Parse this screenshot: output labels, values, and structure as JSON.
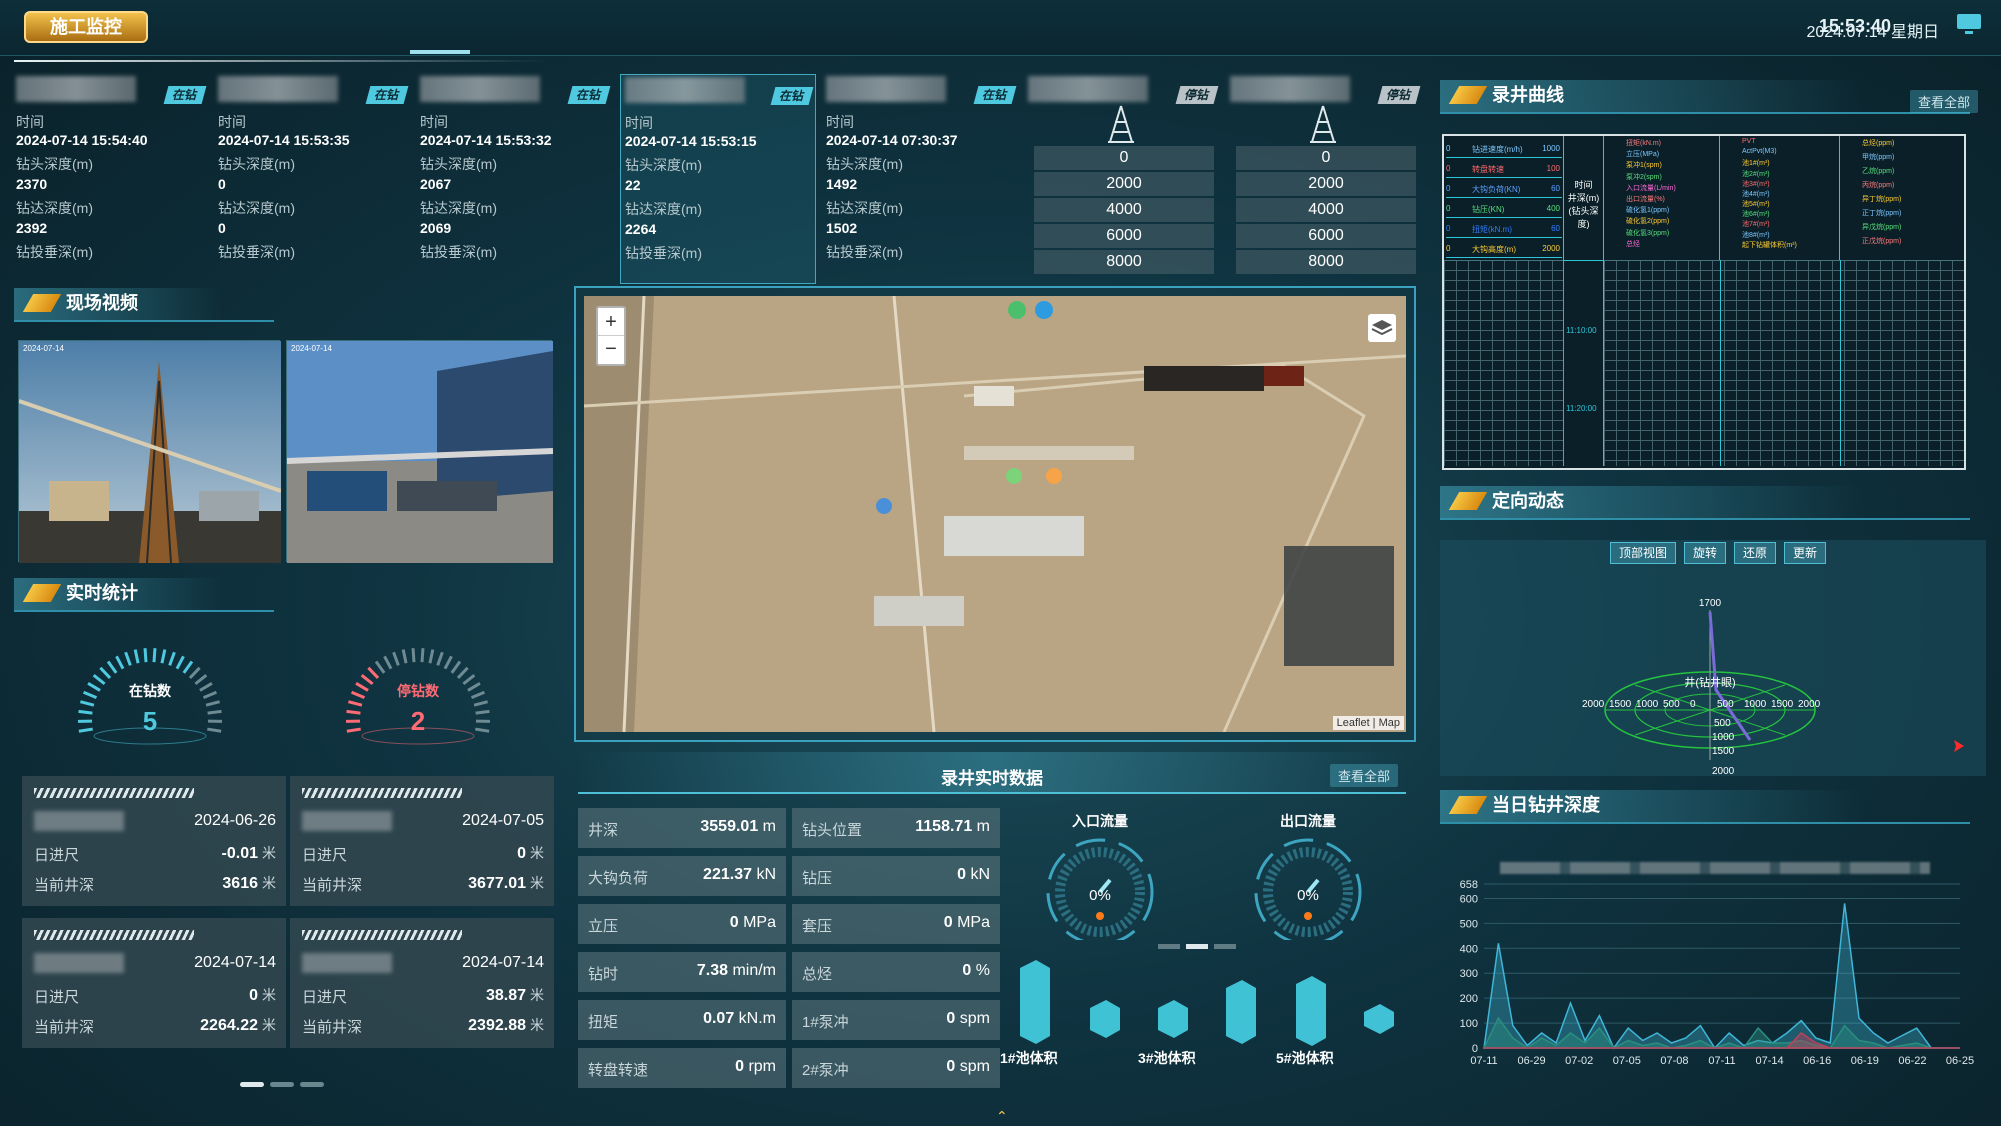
{
  "header": {
    "nav_button": "施工监控",
    "time": "15:53:40",
    "date": "2024.07.14 星期日"
  },
  "wells": [
    {
      "status": "在钻",
      "status_kind": "on",
      "time_label": "时间",
      "time": "2024-07-14 15:54:40",
      "bit_label": "钻头深度(m)",
      "bit": "2370",
      "reach_label": "钻达深度(m)",
      "reach": "2392",
      "vert_label": "钻投垂深(m)"
    },
    {
      "status": "在钻",
      "status_kind": "on",
      "time_label": "时间",
      "time": "2024-07-14 15:53:35",
      "bit_label": "钻头深度(m)",
      "bit": "0",
      "reach_label": "钻达深度(m)",
      "reach": "0",
      "vert_label": "钻投垂深(m)"
    },
    {
      "status": "在钻",
      "status_kind": "on",
      "time_label": "时间",
      "time": "2024-07-14 15:53:32",
      "bit_label": "钻头深度(m)",
      "bit": "2067",
      "reach_label": "钻达深度(m)",
      "reach": "2069",
      "vert_label": "钻投垂深(m)"
    },
    {
      "status": "在钻",
      "status_kind": "on",
      "time_label": "时间",
      "time": "2024-07-14 15:53:15",
      "bit_label": "钻头深度(m)",
      "bit": "22",
      "reach_label": "钻达深度(m)",
      "reach": "2264",
      "vert_label": "钻投垂深(m)"
    },
    {
      "status": "在钻",
      "status_kind": "on",
      "time_label": "时间",
      "time": "2024-07-14 07:30:37",
      "bit_label": "钻头深度(m)",
      "bit": "1492",
      "reach_label": "钻达深度(m)",
      "reach": "1502",
      "vert_label": "钻投垂深(m)"
    },
    {
      "status": "停钻",
      "status_kind": "off",
      "depths": [
        "0",
        "2000",
        "4000",
        "6000",
        "8000"
      ]
    },
    {
      "status": "停钻",
      "status_kind": "off",
      "depths": [
        "0",
        "2000",
        "4000",
        "6000",
        "8000"
      ]
    }
  ],
  "sections": {
    "video": "现场视频",
    "stats": "实时统计",
    "log_curve": "录井曲线",
    "directional": "定向动态",
    "daily_depth": "当日钻井深度",
    "realtime": "录井实时数据",
    "view_all": "查看全部"
  },
  "gauges": {
    "drilling_label": "在钻数",
    "drilling_count": "5",
    "stopped_label": "停钻数",
    "stopped_count": "2",
    "drilling_level": 0.7,
    "stopped_level": 0.3
  },
  "stat_cards": [
    {
      "date": "2024-06-26",
      "footage_label": "日进尺",
      "footage": "-0.01",
      "depth_label": "当前井深",
      "depth": "3616",
      "unit": "米"
    },
    {
      "date": "2024-07-05",
      "footage_label": "日进尺",
      "footage": "0",
      "depth_label": "当前井深",
      "depth": "3677.01",
      "unit": "米"
    },
    {
      "date": "2024-07-14",
      "footage_label": "日进尺",
      "footage": "0",
      "depth_label": "当前井深",
      "depth": "2264.22",
      "unit": "米"
    },
    {
      "date": "2024-07-14",
      "footage_label": "日进尺",
      "footage": "38.87",
      "depth_label": "当前井深",
      "depth": "2392.88",
      "unit": "米"
    }
  ],
  "map": {
    "zoom_in": "+",
    "zoom_out": "−",
    "attribution": "Leaflet | Map"
  },
  "realtime": [
    [
      {
        "k": "井深",
        "v": "3559.01",
        "u": "m"
      },
      {
        "k": "钻头位置",
        "v": "1158.71",
        "u": "m"
      }
    ],
    [
      {
        "k": "大钩负荷",
        "v": "221.37",
        "u": "kN"
      },
      {
        "k": "钻压",
        "v": "0",
        "u": "kN"
      }
    ],
    [
      {
        "k": "立压",
        "v": "0",
        "u": "MPa"
      },
      {
        "k": "套压",
        "v": "0",
        "u": "MPa"
      }
    ],
    [
      {
        "k": "钻时",
        "v": "7.38",
        "u": "min/m"
      },
      {
        "k": "总烃",
        "v": "0",
        "u": "%"
      }
    ],
    [
      {
        "k": "扭矩",
        "v": "0.07",
        "u": "kN.m"
      },
      {
        "k": "1#泵冲",
        "v": "0",
        "u": "spm"
      }
    ],
    [
      {
        "k": "转盘转速",
        "v": "0",
        "u": "rpm"
      },
      {
        "k": "2#泵冲",
        "v": "0",
        "u": "spm"
      }
    ]
  ],
  "flow": {
    "in_label": "入口流量",
    "in_value": "0%",
    "out_label": "出口流量",
    "out_value": "0%"
  },
  "pools": {
    "labels": [
      "1#池体积",
      "3#池体积",
      "5#池体积"
    ]
  },
  "log_chart": {
    "time_header": "时间",
    "depth_header": "井深(m)\n(钻头深度)",
    "col1": [
      {
        "n": "钻进速度(m/h)",
        "max": "1000",
        "c": "#7ec8ff"
      },
      {
        "n": "转盘转速",
        "max": "100",
        "c": "#ff6b6b"
      },
      {
        "n": "大钩负荷(KN)",
        "max": "60",
        "c": "#5aa0ff"
      },
      {
        "n": "钻压(KN)",
        "max": "400",
        "c": "#58e07a"
      },
      {
        "n": "扭矩(kN.m)",
        "max": "60",
        "c": "#2f7cff"
      },
      {
        "n": "大钩高度(m)",
        "max": "2000",
        "c": "#ffcc33"
      }
    ],
    "col3": [
      "扭矩(kN.m)",
      "立压(MPa)",
      "泵冲1(spm)",
      "泵冲2(spm)",
      "入口流量(L/min)",
      "出口流量(%)",
      "硫化氢1(ppm)",
      "硫化氢2(ppm)",
      "硫化氢3(ppm)",
      "总烃"
    ],
    "col4": [
      "PVT",
      "ActPvt(M3)",
      "池1#(m³)",
      "池2#(m³)",
      "池3#(m³)",
      "池4#(m³)",
      "池5#(m³)",
      "池6#(m³)",
      "池7#(m³)",
      "池8#(m³)",
      "起下钻罐体积(m³)"
    ],
    "col5": [
      "总烃(ppm)",
      "甲烷(ppm)",
      "乙烷(ppm)",
      "丙烷(ppm)",
      "异丁烷(ppm)",
      "正丁烷(ppm)",
      "异戊烷(ppm)",
      "正戊烷(ppm)"
    ],
    "times": [
      "11:10:00",
      "11:20:00"
    ]
  },
  "directional": {
    "buttons": [
      "顶部视图",
      "旋转",
      "还原",
      "更新"
    ],
    "label": "井(钻井眼)",
    "axis": [
      "1700",
      "500",
      "1000",
      "1500",
      "2000"
    ],
    "polar": [
      "2000",
      "1500",
      "1000",
      "500",
      "0",
      "500",
      "1000",
      "1500",
      "2000"
    ]
  },
  "chart_data": {
    "type": "area",
    "title": "当日钻井深度",
    "categories": [
      "07-11",
      "06-29",
      "07-02",
      "07-05",
      "07-08",
      "07-11",
      "07-14",
      "06-16",
      "06-19",
      "06-22",
      "06-25"
    ],
    "yticks": [
      0,
      100,
      200,
      300,
      400,
      500,
      600,
      658
    ],
    "ylim": [
      0,
      658
    ],
    "series": [
      {
        "values": [
          0,
          420,
          90,
          10,
          60,
          20,
          180,
          30,
          130,
          0,
          80,
          30,
          60,
          20,
          40,
          90,
          0,
          60,
          10,
          30,
          20,
          60,
          110,
          40,
          20,
          580,
          120,
          60,
          20,
          50,
          80,
          0,
          0,
          0
        ],
        "color": "#3fb6d8"
      },
      {
        "values": [
          0,
          120,
          40,
          0,
          40,
          10,
          60,
          20,
          80,
          0,
          30,
          10,
          20,
          0,
          10,
          30,
          0,
          20,
          0,
          80,
          20,
          20,
          30,
          10,
          0,
          90,
          30,
          20,
          0,
          10,
          20,
          0,
          0,
          0
        ],
        "color": "#2a8e7e"
      },
      {
        "values": [
          0,
          0,
          0,
          0,
          0,
          0,
          0,
          0,
          0,
          0,
          0,
          0,
          0,
          0,
          0,
          0,
          0,
          0,
          0,
          0,
          0,
          0,
          60,
          20,
          0,
          0,
          0,
          0,
          0,
          0,
          0,
          0,
          0,
          0
        ],
        "color": "#c0415a"
      }
    ]
  }
}
